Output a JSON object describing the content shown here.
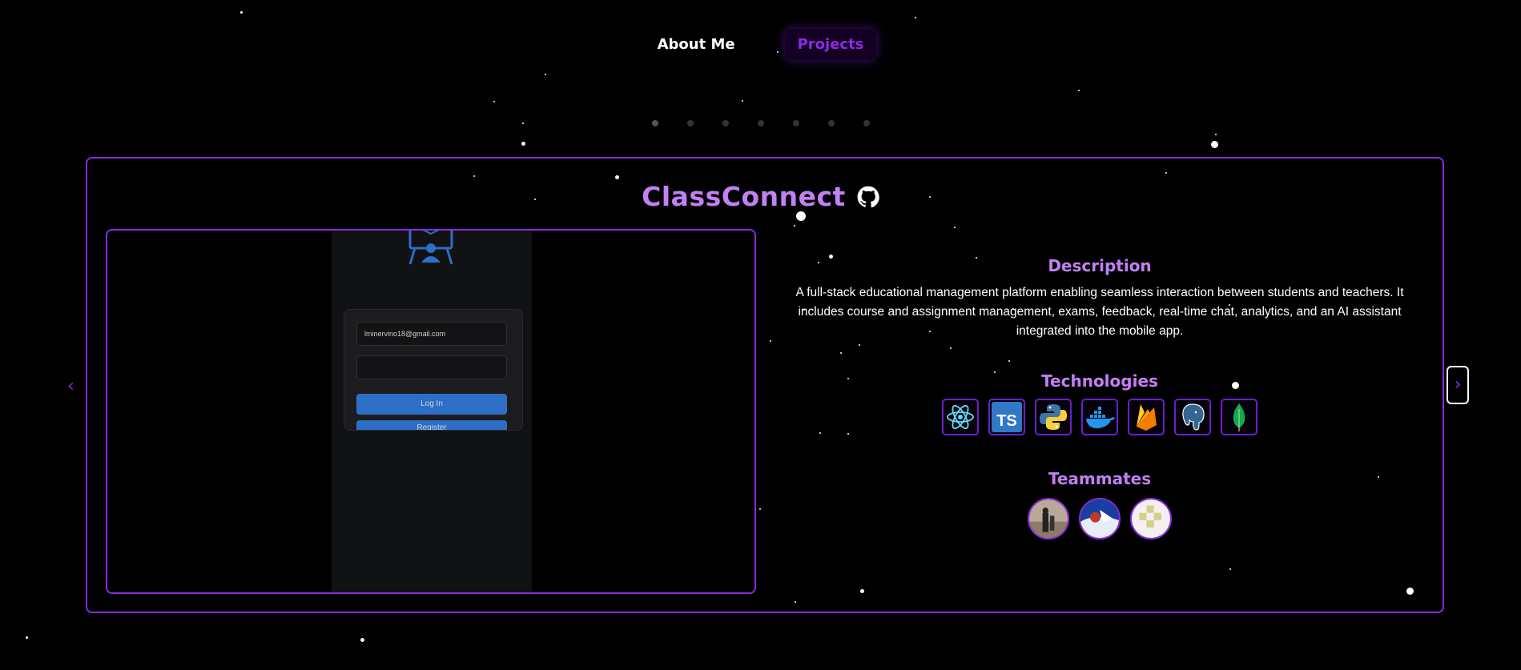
{
  "nav": {
    "about_label": "About Me",
    "projects_label": "Projects"
  },
  "carousel": {
    "slide_count": 7,
    "active_index": 0,
    "prev_label": "‹",
    "next_label": "›"
  },
  "project": {
    "title": "ClassConnect",
    "github_icon": "github-icon",
    "preview": {
      "email_value": "lminervino18@gmail.com",
      "password_value": "",
      "login_label": "Log In",
      "register_label": "Register"
    },
    "description_heading": "Description",
    "description": "A full-stack educational management platform enabling seamless interaction between students and teachers. It includes course and assignment management, exams, feedback, real-time chat, analytics, and an AI assistant integrated into the mobile app.",
    "technologies_heading": "Technologies",
    "technologies": [
      {
        "name": "react-icon"
      },
      {
        "name": "typescript-icon"
      },
      {
        "name": "python-icon"
      },
      {
        "name": "docker-icon"
      },
      {
        "name": "firebase-icon"
      },
      {
        "name": "postgresql-icon"
      },
      {
        "name": "mongodb-icon"
      }
    ],
    "teammates_heading": "Teammates",
    "teammates": [
      {
        "name": "teammate-avatar-1"
      },
      {
        "name": "teammate-avatar-2"
      },
      {
        "name": "teammate-avatar-3"
      }
    ]
  },
  "colors": {
    "accent": "#8a2be2",
    "heading": "#c280f5",
    "background": "#000000"
  }
}
